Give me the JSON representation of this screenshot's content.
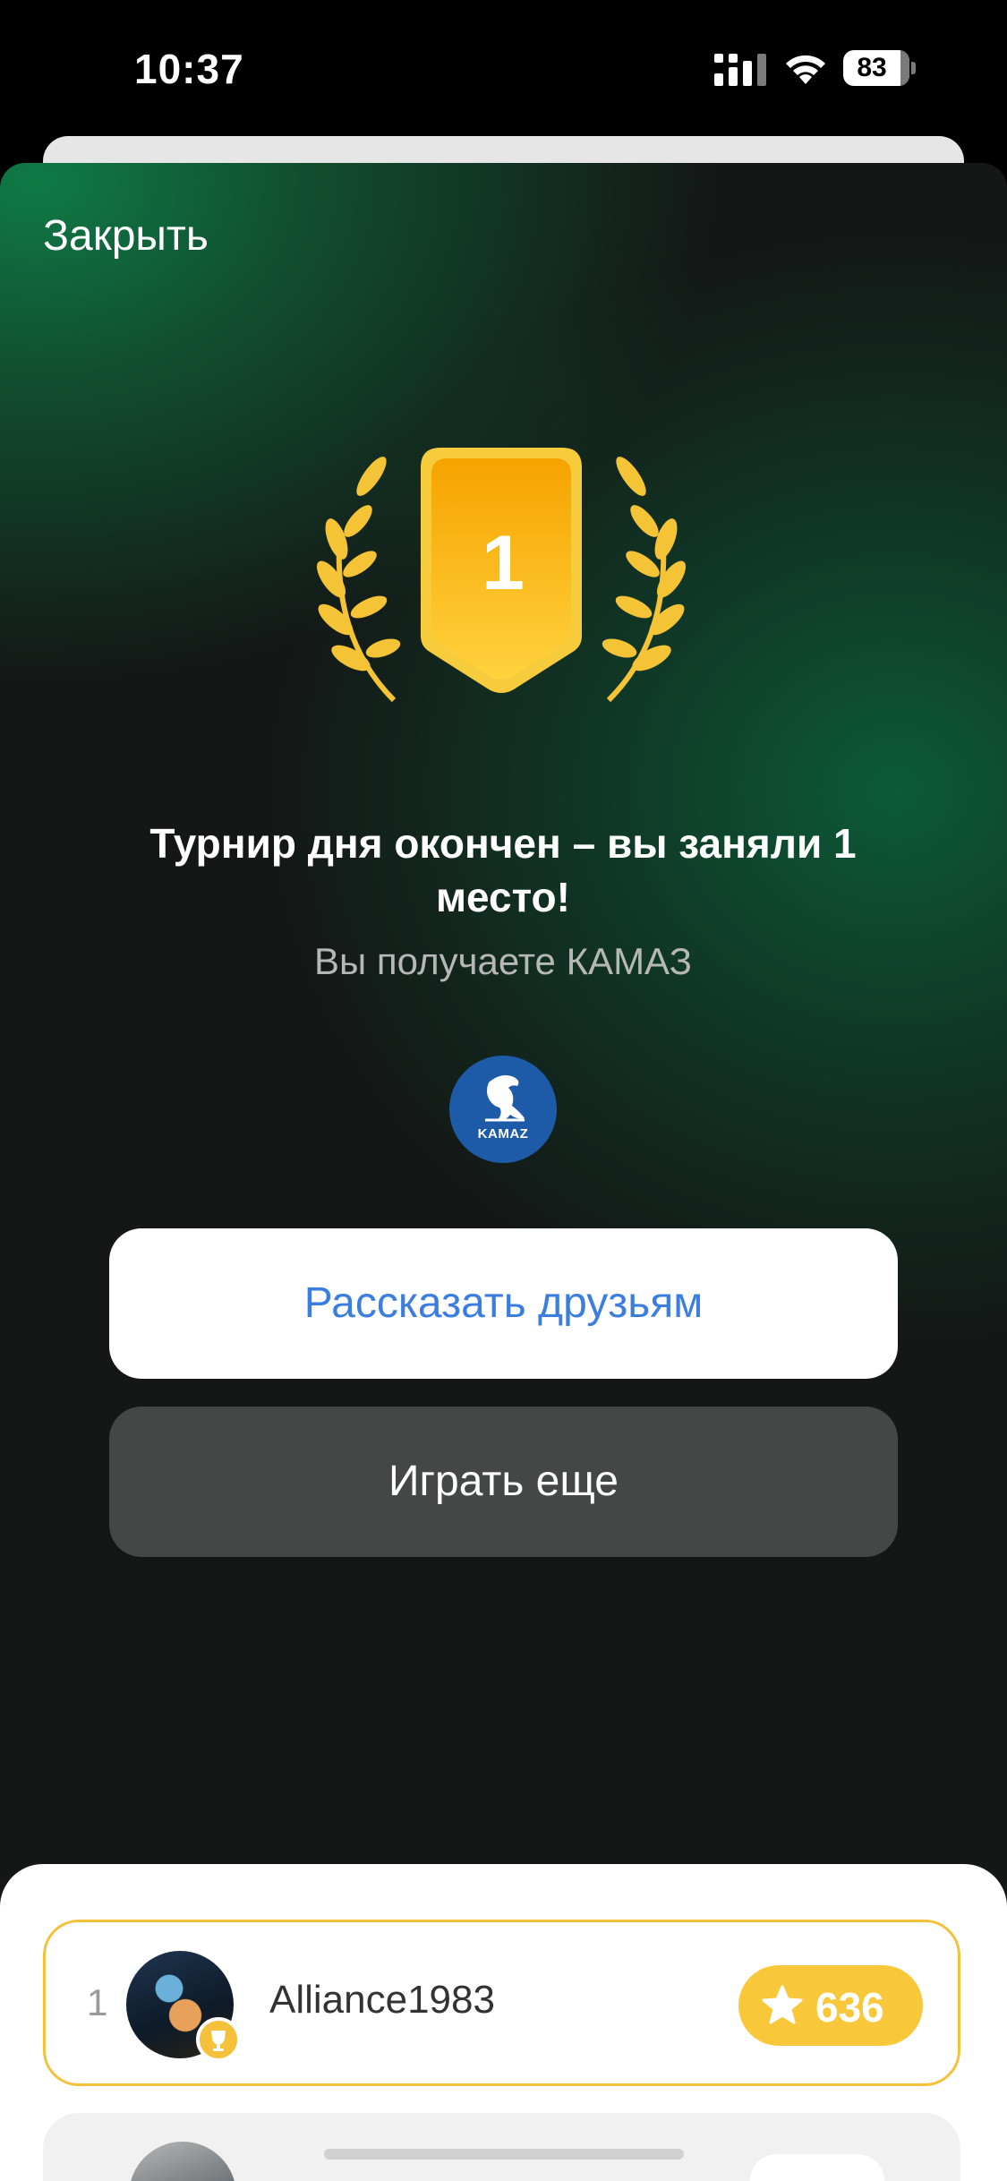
{
  "status_bar": {
    "time": "10:37",
    "battery": "83"
  },
  "modal": {
    "close_label": "Закрыть",
    "place_number": "1",
    "title": "Турнир дня окончен – вы заняли 1 место!",
    "subtitle": "Вы получаете КАМАЗ",
    "team_logo_text": "KAMAZ",
    "share_button": "Рассказать друзьям",
    "play_button": "Играть еще"
  },
  "leaderboard": {
    "rows": [
      {
        "rank": "1",
        "username": "Alliance1983",
        "score": "636"
      }
    ]
  },
  "colors": {
    "accent_gold": "#f8c83a",
    "link_blue": "#3c7ee0",
    "bg_green": "#0f7a45"
  }
}
